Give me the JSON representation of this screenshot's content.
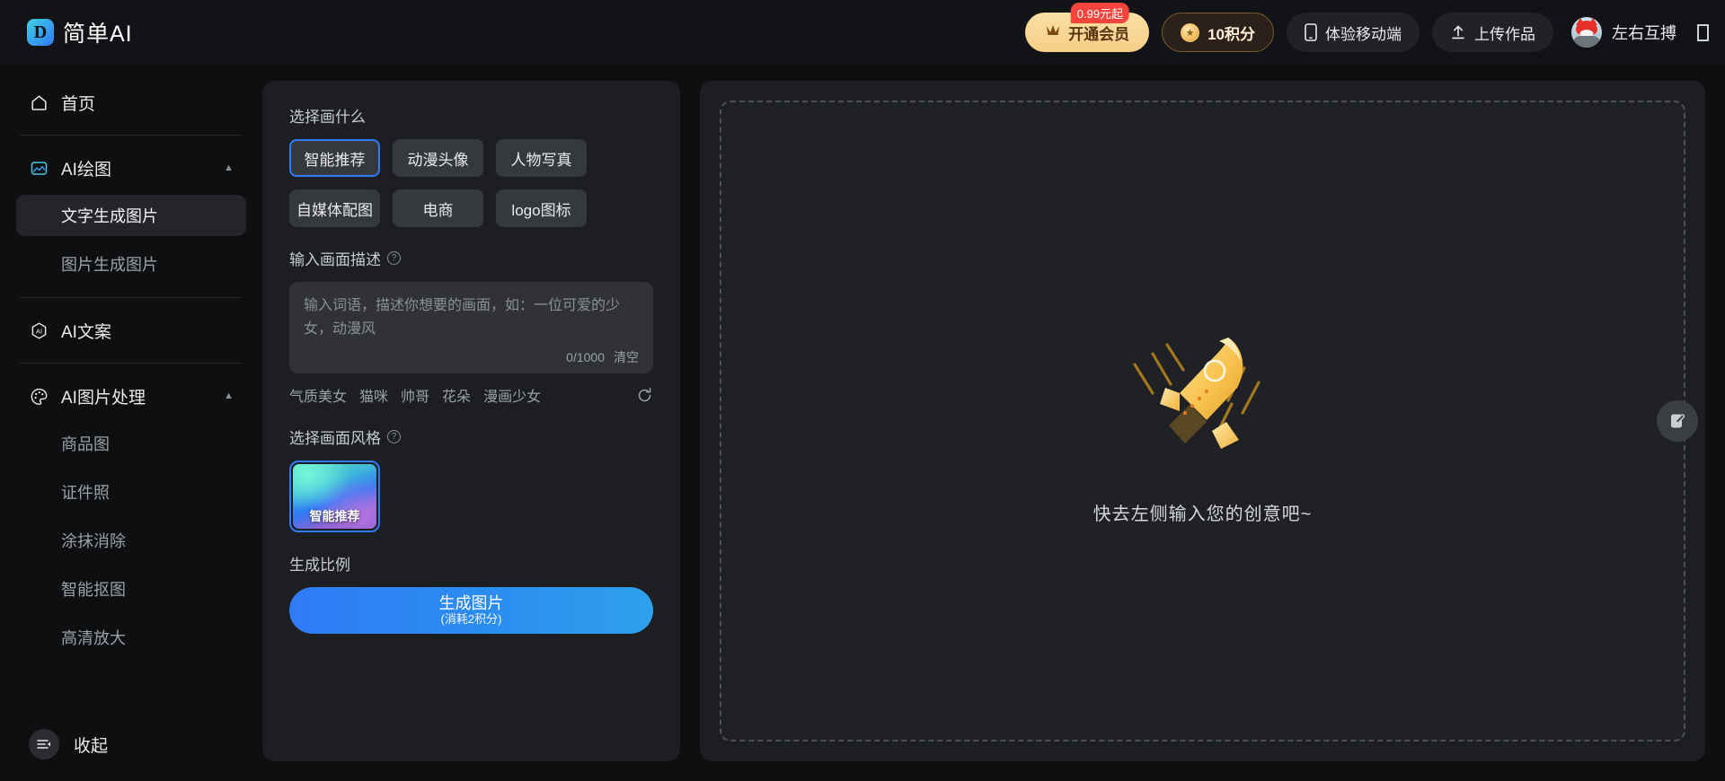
{
  "header": {
    "brand_mark": "D",
    "brand_name": "简单AI",
    "vip_button": "开通会员",
    "vip_badge": "0.99元起",
    "points_button": "10积分",
    "mobile_button": "体验移动端",
    "upload_button": "上传作品",
    "username": "左右互搏",
    "icons": {
      "vip": "crown-icon",
      "coin": "coin-icon",
      "mobile": "phone-icon",
      "upload": "upload-icon",
      "avatar": "avatar",
      "trailing": "missing-glyph-icon"
    }
  },
  "sidebar": {
    "items": [
      {
        "label": "首页",
        "icon": "home-icon",
        "type": "nav"
      },
      {
        "label": "AI绘图",
        "icon": "image-icon",
        "type": "group",
        "expanded": true
      },
      {
        "label": "文字生成图片",
        "type": "sub",
        "active": true
      },
      {
        "label": "图片生成图片",
        "type": "sub",
        "active": false
      },
      {
        "label": "AI文案",
        "icon": "ai-hex-icon",
        "type": "nav"
      },
      {
        "label": "AI图片处理",
        "icon": "palette-icon",
        "type": "group",
        "expanded": true
      },
      {
        "label": "商品图",
        "type": "sub",
        "active": false
      },
      {
        "label": "证件照",
        "type": "sub",
        "active": false
      },
      {
        "label": "涂抹消除",
        "type": "sub",
        "active": false
      },
      {
        "label": "智能抠图",
        "type": "sub",
        "active": false
      },
      {
        "label": "高清放大",
        "type": "sub",
        "active": false
      }
    ],
    "collapse_label": "收起"
  },
  "left_panel": {
    "subject_label": "选择画什么",
    "subjects": [
      {
        "label": "智能推荐",
        "selected": true
      },
      {
        "label": "动漫头像",
        "selected": false
      },
      {
        "label": "人物写真",
        "selected": false
      },
      {
        "label": "自媒体配图",
        "selected": false
      },
      {
        "label": "电商",
        "selected": false
      },
      {
        "label": "logo图标",
        "selected": false
      }
    ],
    "prompt_label": "输入画面描述",
    "prompt_value": "",
    "prompt_placeholder": "输入词语，描述你想要的画面，如：一位可爱的少女，动漫风",
    "prompt_counter": "0/1000",
    "prompt_clear": "清空",
    "tags": [
      "气质美女",
      "猫咪",
      "帅哥",
      "花朵",
      "漫画少女"
    ],
    "refresh_icon": "refresh-icon",
    "style_label": "选择画面风格",
    "styles": [
      {
        "label": "智能推荐",
        "selected": true
      }
    ],
    "ratio_label": "生成比例",
    "generate_title": "生成图片",
    "generate_sub": "(消耗2积分)"
  },
  "right_panel": {
    "empty_text": "快去左侧输入您的创意吧~",
    "empty_illustration": "rocket-illustration",
    "edit_fab_icon": "edit-document-icon"
  },
  "colors": {
    "accent_blue": "#2f7bf6",
    "vip_gold": "#f6cf86",
    "badge_red": "#f4443c",
    "panel_bg": "#1c1e21",
    "page_bg": "#0e0f11"
  }
}
